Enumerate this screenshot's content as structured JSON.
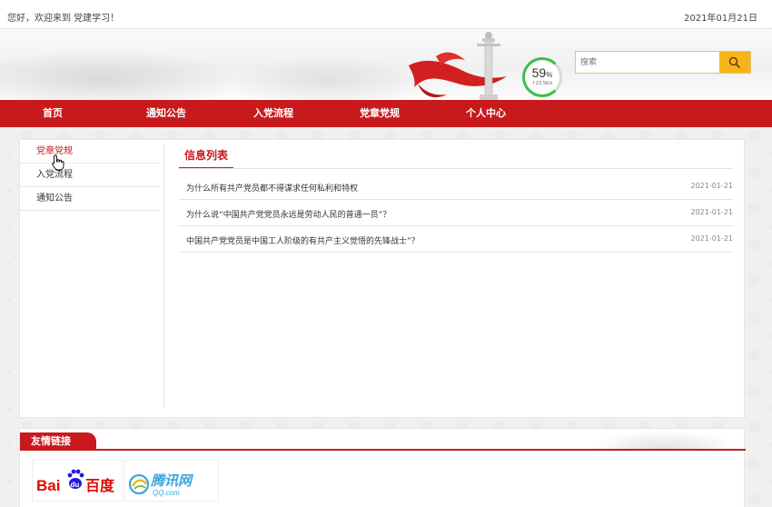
{
  "topbar": {
    "welcome": "您好，欢迎来到 党建学习！",
    "date": "2021年01月21日"
  },
  "widget": {
    "percent": "59",
    "percent_unit": "%",
    "rate": "↑23.5K/s"
  },
  "search": {
    "placeholder": "搜索",
    "icon": "search-icon"
  },
  "nav": {
    "items": [
      {
        "label": "首页"
      },
      {
        "label": "通知公告"
      },
      {
        "label": "入党流程"
      },
      {
        "label": "党章党规"
      },
      {
        "label": "个人中心"
      }
    ]
  },
  "sidebar": {
    "items": [
      {
        "label": "党章党规",
        "active": true
      },
      {
        "label": "入党流程",
        "active": false
      },
      {
        "label": "通知公告",
        "active": false
      }
    ]
  },
  "main": {
    "title": "信息列表",
    "rows": [
      {
        "title": "为什么所有共产党员都不得谋求任何私利和特权",
        "date": "2021-01-21"
      },
      {
        "title": "为什么说“中国共产党党员永远是劳动人民的普通一员”？",
        "date": "2021-01-21"
      },
      {
        "title": "中国共产党党员是中国工人阶级的有共产主义觉悟的先锋战士”？",
        "date": "2021-01-21"
      }
    ]
  },
  "links": {
    "title": "友情链接",
    "baidu": {
      "text1": "Bai",
      "text2": "du",
      "text3": "百度"
    },
    "qq": {
      "text1": "腾讯网",
      "text2": "QQ.com"
    }
  },
  "colors": {
    "brand_red": "#c8191c",
    "search_button": "#f7b41a",
    "speed_green": "#3cbf4a"
  }
}
